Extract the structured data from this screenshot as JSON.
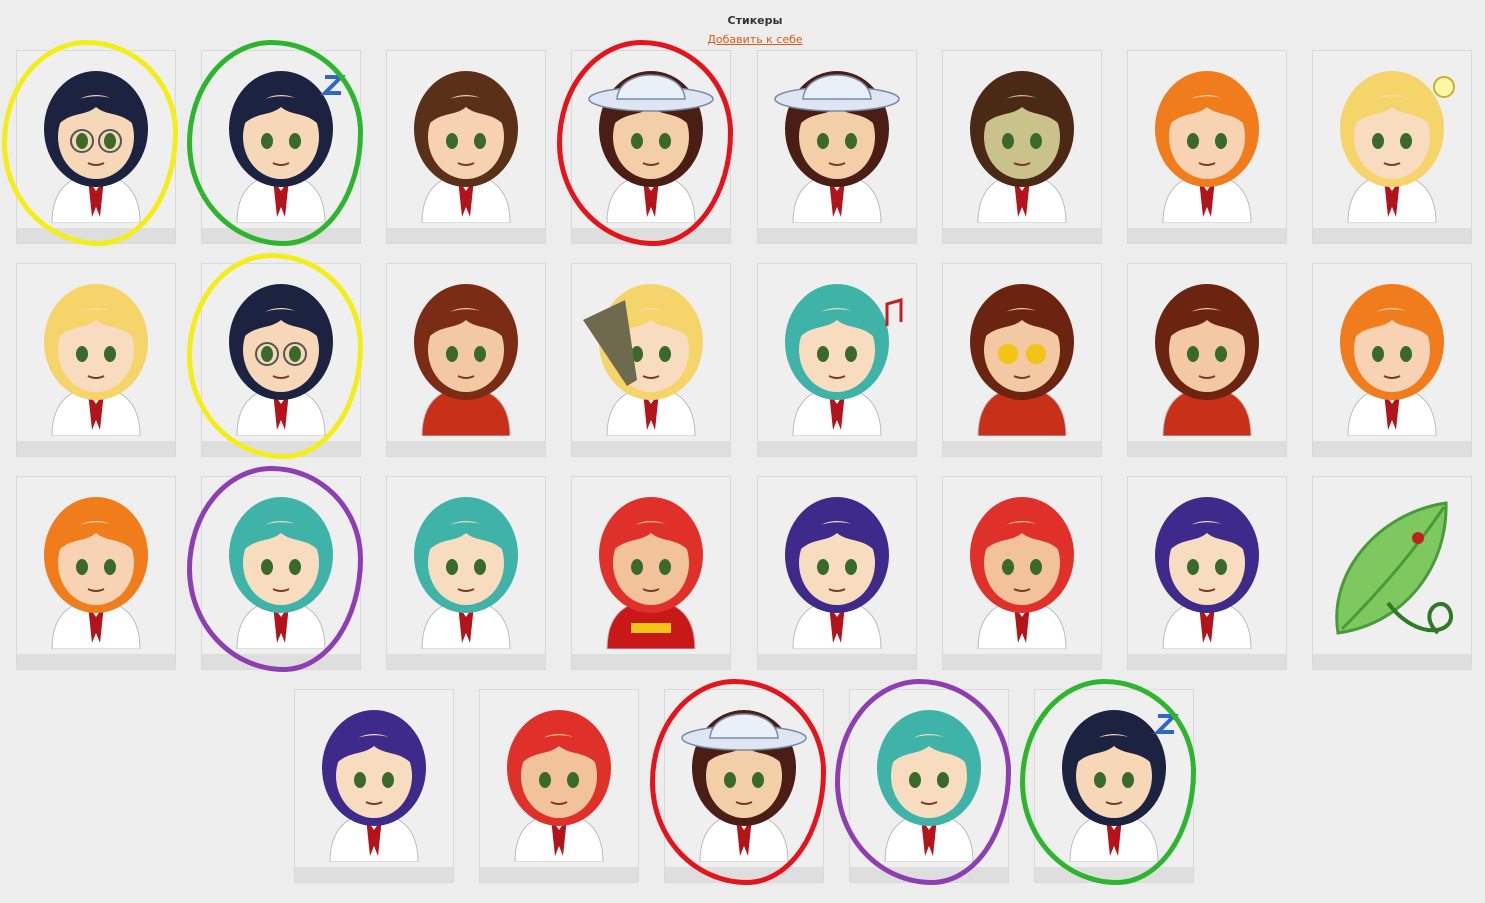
{
  "header": {
    "title": "Стикеры",
    "add_link": "Добавить к себе"
  },
  "colors": {
    "background": "#ededed",
    "tile": "#efefef",
    "tile_bar": "#dedede",
    "link": "#e05a12",
    "marker_yellow": "#f3ee1a",
    "marker_green": "#2db52d",
    "marker_red": "#e5141c",
    "marker_purple": "#8d3eb3"
  },
  "stickers": [
    {
      "name": "dark-hair-glasses-arms-crossed",
      "hair": "#1b2340",
      "skin": "#f6d7b8",
      "shirt": "#ffffff",
      "extra": "glasses"
    },
    {
      "name": "dark-hair-glasses-sleeping",
      "hair": "#1b2340",
      "skin": "#f6d7b8",
      "shirt": "#ffffff",
      "extra": "zzz"
    },
    {
      "name": "brown-hair-facepalm",
      "hair": "#5a3018",
      "skin": "#f6d2b0",
      "shirt": "#ffffff",
      "extra": "none"
    },
    {
      "name": "panama-hat-shrug",
      "hair": "#4a1e14",
      "skin": "#f2cfa6",
      "shirt": "#ffffff",
      "extra": "hat"
    },
    {
      "name": "panama-hat-surprised",
      "hair": "#4a1e14",
      "skin": "#f2cfa6",
      "shirt": "#ffffff",
      "extra": "hat"
    },
    {
      "name": "brown-hair-sick",
      "hair": "#4a2a14",
      "skin": "#c9c28a",
      "shirt": "#ffffff",
      "extra": "none"
    },
    {
      "name": "orange-pigtails-angry",
      "hair": "#f07c1c",
      "skin": "#f7d3b3",
      "shirt": "#ffffff",
      "extra": "none"
    },
    {
      "name": "blonde-idea-lightbulb",
      "hair": "#f5d46a",
      "skin": "#f8dcc0",
      "shirt": "#ffffff",
      "extra": "bulb"
    },
    {
      "name": "blonde-braid-neutral",
      "hair": "#f5d46a",
      "skin": "#f8dcc0",
      "shirt": "#ffffff",
      "extra": "none"
    },
    {
      "name": "dark-hair-glasses-arms-crossed-2",
      "hair": "#1b2340",
      "skin": "#f6d7b8",
      "shirt": "#ffffff",
      "extra": "glasses"
    },
    {
      "name": "cat-ears-scared",
      "hair": "#7a2c14",
      "skin": "#f2c9a3",
      "shirt": "#c83018",
      "extra": "none"
    },
    {
      "name": "blonde-broom",
      "hair": "#f5d46a",
      "skin": "#f8dcc0",
      "shirt": "#ffffff",
      "extra": "broom"
    },
    {
      "name": "teal-twintails-singing",
      "hair": "#3fb3a8",
      "skin": "#f8dcc0",
      "shirt": "#ffffff",
      "extra": "note"
    },
    {
      "name": "cat-ears-heart-eyes",
      "hair": "#6a2410",
      "skin": "#f2c9a3",
      "shirt": "#c83018",
      "extra": "hearts"
    },
    {
      "name": "cat-ears-bored",
      "hair": "#6a2410",
      "skin": "#f2c9a3",
      "shirt": "#c83018",
      "extra": "none"
    },
    {
      "name": "orange-pigtails-laughing",
      "hair": "#f07c1c",
      "skin": "#f7d3b3",
      "shirt": "#ffffff",
      "extra": "none"
    },
    {
      "name": "orange-pigtails-sad",
      "hair": "#f07c1c",
      "skin": "#f7d3b3",
      "shirt": "#ffffff",
      "extra": "none"
    },
    {
      "name": "teal-twintails-dreamy",
      "hair": "#3fb3a8",
      "skin": "#f8dcc0",
      "shirt": "#ffffff",
      "extra": "none"
    },
    {
      "name": "teal-twintails-worried",
      "hair": "#3fb3a8",
      "skin": "#f8dcc0",
      "shirt": "#ffffff",
      "extra": "none"
    },
    {
      "name": "red-hair-cccp-skeptical",
      "hair": "#e0302a",
      "skin": "#f2c39a",
      "shirt": "#c81818",
      "extra": "cccp"
    },
    {
      "name": "purple-hair-praying",
      "hair": "#3e2a8a",
      "skin": "#f8dcc0",
      "shirt": "#ffffff",
      "extra": "none"
    },
    {
      "name": "red-hair-laughing-tears",
      "hair": "#e0302a",
      "skin": "#f2c39a",
      "shirt": "#ffffff",
      "extra": "none"
    },
    {
      "name": "purple-hair-blushing",
      "hair": "#3e2a8a",
      "skin": "#f8dcc0",
      "shirt": "#ffffff",
      "extra": "none"
    },
    {
      "name": "leaf-ladybug",
      "hair": "#4a9a3a",
      "skin": "#7ec860",
      "shirt": "#4a9a3a",
      "extra": "leaf"
    },
    {
      "name": "purple-hair-grin",
      "hair": "#3e2a8a",
      "skin": "#f8dcc0",
      "shirt": "#ffffff",
      "extra": "none"
    },
    {
      "name": "red-hair-wink-tongue",
      "hair": "#e0302a",
      "skin": "#f2c39a",
      "shirt": "#ffffff",
      "extra": "none"
    },
    {
      "name": "panama-hat-shrug-2",
      "hair": "#4a1e14",
      "skin": "#f2cfa6",
      "shirt": "#ffffff",
      "extra": "hat"
    },
    {
      "name": "teal-twintails-dreamy-2",
      "hair": "#3fb3a8",
      "skin": "#f8dcc0",
      "shirt": "#ffffff",
      "extra": "none"
    },
    {
      "name": "dark-hair-glasses-sleeping-2",
      "hair": "#1b2340",
      "skin": "#f6d7b8",
      "shirt": "#ffffff",
      "extra": "zzz"
    }
  ],
  "annotations": [
    {
      "color": "yellow",
      "sticker": 0
    },
    {
      "color": "green",
      "sticker": 1
    },
    {
      "color": "red",
      "sticker": 3
    },
    {
      "color": "yellow",
      "sticker": 9
    },
    {
      "color": "purple",
      "sticker": 17
    },
    {
      "color": "red",
      "sticker": 26
    },
    {
      "color": "purple",
      "sticker": 27
    },
    {
      "color": "green",
      "sticker": 28
    }
  ]
}
